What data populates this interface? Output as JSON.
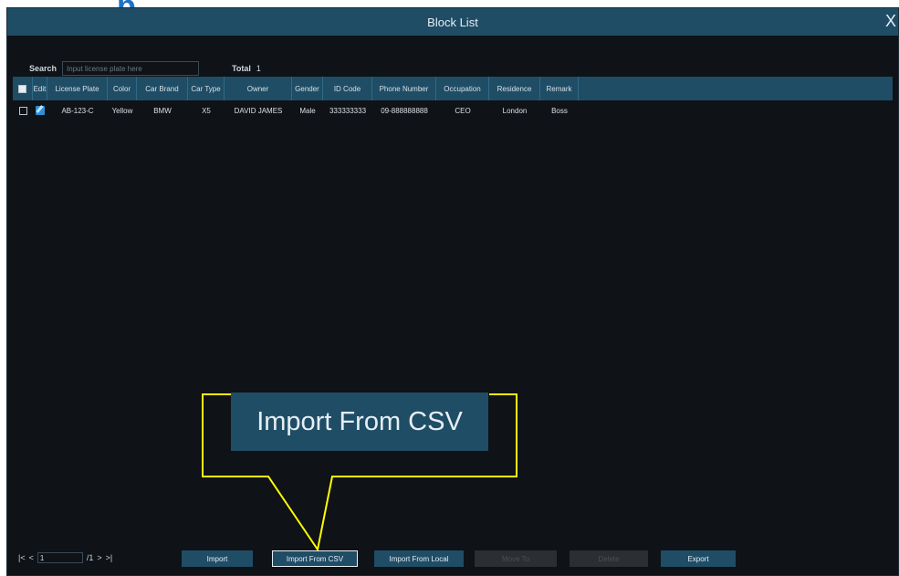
{
  "header_fragment": "p",
  "window": {
    "title": "Block List",
    "close_label": "X"
  },
  "search": {
    "label": "Search",
    "placeholder": "Input license plate here",
    "total_label": "Total",
    "total_value": "1"
  },
  "table": {
    "columns": [
      "Edit",
      "License Plate",
      "Color",
      "Car Brand",
      "Car Type",
      "Owner",
      "Gender",
      "ID Code",
      "Phone Number",
      "Occupation",
      "Residence",
      "Remark"
    ],
    "rows": [
      {
        "license_plate": "AB-123-C",
        "color": "Yellow",
        "car_brand": "BMW",
        "car_type": "X5",
        "owner": "DAVID JAMES",
        "gender": "Male",
        "id_code": "333333333",
        "phone": "09-888888888",
        "occupation": "CEO",
        "residence": "London",
        "remark": "Boss"
      }
    ]
  },
  "callout": {
    "text": "Import From CSV"
  },
  "colors": {
    "accent": "#1f4d66",
    "callout_outline": "#ffff00",
    "heading_blue": "#1e73c8"
  },
  "pagination": {
    "first_icon": "|<",
    "prev_icon": "<",
    "current_page": "1",
    "total_pages": "/1",
    "next_icon": ">",
    "last_icon": ">|"
  },
  "buttons": {
    "import": "Import",
    "import_csv": "Import From CSV",
    "import_local": "Import From Local",
    "move_to": "Move To",
    "delete": "Delete",
    "export": "Export"
  }
}
